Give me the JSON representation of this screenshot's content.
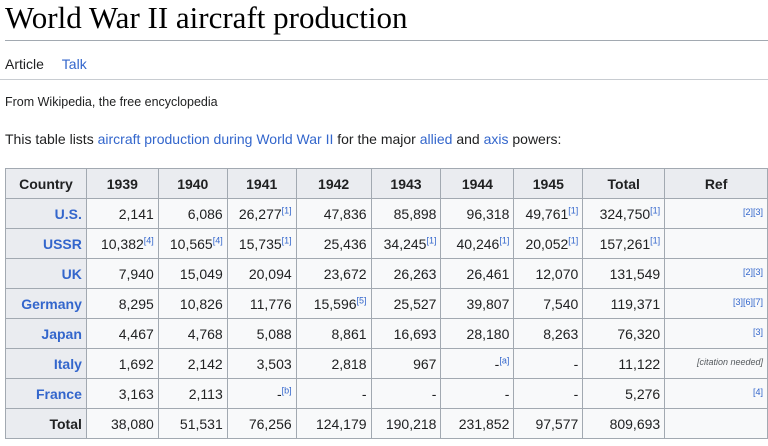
{
  "page": {
    "title": "World War II aircraft production",
    "tabs": [
      {
        "label": "Article",
        "active": true
      },
      {
        "label": "Talk",
        "active": false
      }
    ],
    "tagline": "From Wikipedia, the free encyclopedia",
    "intro": {
      "before": "This table lists ",
      "link1": "aircraft production during World War II",
      "mid1": " for the major ",
      "link2": "allied",
      "mid2": " and ",
      "link3": "axis",
      "after": " powers:"
    }
  },
  "table": {
    "headers": [
      "Country",
      "1939",
      "1940",
      "1941",
      "1942",
      "1943",
      "1944",
      "1945",
      "Total",
      "Ref"
    ],
    "rows": [
      {
        "country": "U.S.",
        "cells": [
          [
            "2,141",
            ""
          ],
          [
            "6,086",
            ""
          ],
          [
            "26,277",
            "[1]"
          ],
          [
            "47,836",
            ""
          ],
          [
            "85,898",
            ""
          ],
          [
            "96,318",
            ""
          ],
          [
            "49,761",
            "[1]"
          ],
          [
            "324,750",
            "[1]"
          ]
        ],
        "ref": "[2][3]"
      },
      {
        "country": "USSR",
        "cells": [
          [
            "10,382",
            "[4]"
          ],
          [
            "10,565",
            "[4]"
          ],
          [
            "15,735",
            "[1]"
          ],
          [
            "25,436",
            ""
          ],
          [
            "34,245",
            "[1]"
          ],
          [
            "40,246",
            "[1]"
          ],
          [
            "20,052",
            "[1]"
          ],
          [
            "157,261",
            "[1]"
          ]
        ],
        "ref": ""
      },
      {
        "country": "UK",
        "cells": [
          [
            "7,940",
            ""
          ],
          [
            "15,049",
            ""
          ],
          [
            "20,094",
            ""
          ],
          [
            "23,672",
            ""
          ],
          [
            "26,263",
            ""
          ],
          [
            "26,461",
            ""
          ],
          [
            "12,070",
            ""
          ],
          [
            "131,549",
            ""
          ]
        ],
        "ref": "[2][3]"
      },
      {
        "country": "Germany",
        "cells": [
          [
            "8,295",
            ""
          ],
          [
            "10,826",
            ""
          ],
          [
            "11,776",
            ""
          ],
          [
            "15,596",
            "[5]"
          ],
          [
            "25,527",
            ""
          ],
          [
            "39,807",
            ""
          ],
          [
            "7,540",
            ""
          ],
          [
            "119,371",
            ""
          ]
        ],
        "ref": "[3][6][7]"
      },
      {
        "country": "Japan",
        "cells": [
          [
            "4,467",
            ""
          ],
          [
            "4,768",
            ""
          ],
          [
            "5,088",
            ""
          ],
          [
            "8,861",
            ""
          ],
          [
            "16,693",
            ""
          ],
          [
            "28,180",
            ""
          ],
          [
            "8,263",
            ""
          ],
          [
            "76,320",
            ""
          ]
        ],
        "ref": "[3]"
      },
      {
        "country": "Italy",
        "cells": [
          [
            "1,692",
            ""
          ],
          [
            "2,142",
            ""
          ],
          [
            "3,503",
            ""
          ],
          [
            "2,818",
            ""
          ],
          [
            "967",
            ""
          ],
          [
            "-",
            "[a]"
          ],
          [
            "-",
            ""
          ],
          [
            "11,122",
            ""
          ]
        ],
        "ref": "[citation needed]"
      },
      {
        "country": "France",
        "cells": [
          [
            "3,163",
            ""
          ],
          [
            "2,113",
            ""
          ],
          [
            "-",
            "[b]"
          ],
          [
            "-",
            ""
          ],
          [
            "-",
            ""
          ],
          [
            "-",
            ""
          ],
          [
            "-",
            ""
          ],
          [
            "5,276",
            ""
          ]
        ],
        "ref": "[4]"
      }
    ],
    "total": {
      "label": "Total",
      "cells": [
        "38,080",
        "51,531",
        "76,256",
        "124,179",
        "190,218",
        "231,852",
        "97,577",
        "809,693"
      ]
    }
  }
}
